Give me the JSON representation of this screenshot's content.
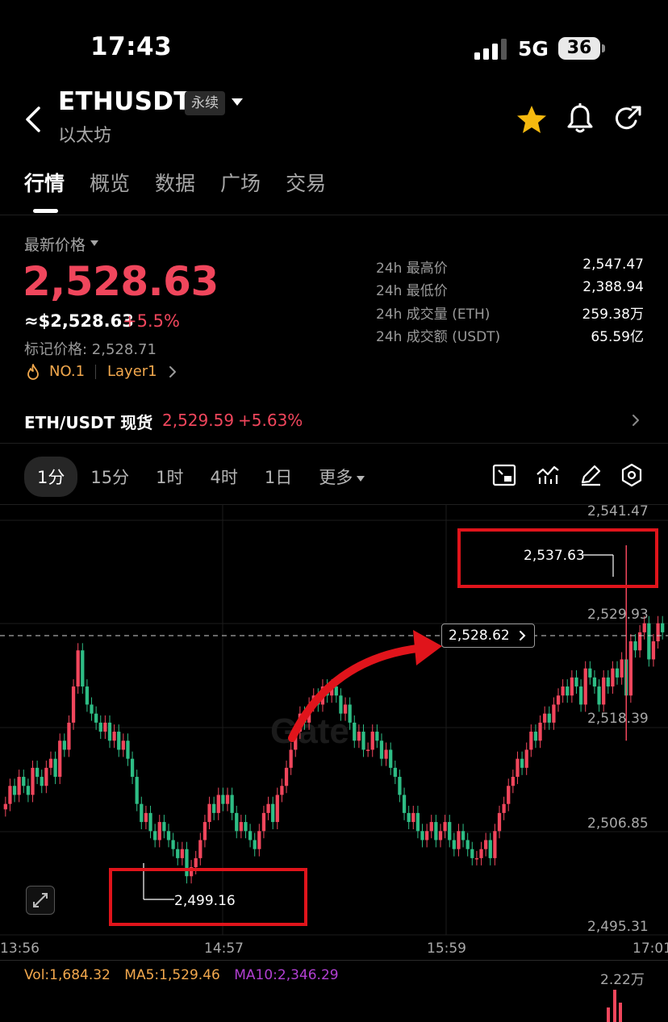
{
  "status_bar": {
    "time": "17:43",
    "network": "5G",
    "battery": "36"
  },
  "header": {
    "pair": "ETHUSDT",
    "contract_type": "永续",
    "name": "以太坊"
  },
  "tabs": [
    {
      "label": "行情",
      "active": true
    },
    {
      "label": "概览",
      "active": false
    },
    {
      "label": "数据",
      "active": false
    },
    {
      "label": "广场",
      "active": false
    },
    {
      "label": "交易",
      "active": false
    }
  ],
  "ticker": {
    "latest_label": "最新价格",
    "price": "2,528.63",
    "usd_price": "≈$2,528.63",
    "change": "+5.5%",
    "mark_price": "标记价格: 2,528.71",
    "rank_tag": "NO.1",
    "sector_tag": "Layer1",
    "stats": [
      {
        "label": "24h 最高价",
        "value": "2,547.47"
      },
      {
        "label": "24h 最低价",
        "value": "2,388.94"
      },
      {
        "label": "24h 成交量 (ETH)",
        "value": "259.38万"
      },
      {
        "label": "24h 成交额 (USDT)",
        "value": "65.59亿"
      }
    ]
  },
  "spot": {
    "name": "ETH/USDT 现货",
    "price": "2,529.59",
    "change": "+5.63%"
  },
  "intervals": [
    {
      "label": "1分",
      "active": true
    },
    {
      "label": "15分",
      "active": false
    },
    {
      "label": "1时",
      "active": false
    },
    {
      "label": "4时",
      "active": false
    },
    {
      "label": "1日",
      "active": false
    },
    {
      "label": "更多",
      "active": false
    }
  ],
  "tool_icons": [
    "chart-layout-icon",
    "indicator-icon",
    "draw-pen-icon",
    "settings-hex-icon"
  ],
  "colors": {
    "up": "#f0465c",
    "down": "#2ebd85",
    "accent": "#f2a84d",
    "annotation": "#e0141b"
  },
  "chart_data": {
    "type": "candlestick",
    "watermark": "Gate",
    "y_tick_labels": [
      "2,541.47",
      "2,529.93",
      "2,518.39",
      "2,506.85",
      "2,495.31"
    ],
    "x_tick_labels": [
      "13:56",
      "14:57",
      "15:59",
      "17:01"
    ],
    "ylim": [
      2495.31,
      2541.47
    ],
    "current_price": "2,528.62",
    "high_marker": "2,537.63",
    "low_marker": "2,499.16",
    "close_series": [
      2509,
      2511,
      2510,
      2512,
      2511,
      2510,
      2513,
      2512,
      2511,
      2513,
      2514,
      2512,
      2516,
      2515,
      2518,
      2522,
      2526,
      2522,
      2520,
      2519,
      2518,
      2517,
      2518,
      2516,
      2517,
      2515,
      2516,
      2514,
      2512,
      2509,
      2507,
      2508,
      2506,
      2505,
      2507,
      2506,
      2505,
      2504,
      2503,
      2504,
      2501,
      2502,
      2503,
      2505,
      2507,
      2509,
      2508,
      2510,
      2509,
      2510,
      2508,
      2506,
      2507,
      2506,
      2505,
      2504,
      2506,
      2508,
      2509,
      2507,
      2510,
      2511,
      2513,
      2515,
      2517,
      2519,
      2518,
      2520,
      2521,
      2520,
      2522,
      2521,
      2522,
      2521,
      2519,
      2520,
      2518,
      2516,
      2517,
      2515,
      2515,
      2517,
      2516,
      2514,
      2515,
      2513,
      2512,
      2510,
      2508,
      2507,
      2508,
      2506,
      2505,
      2506,
      2507,
      2505,
      2506,
      2507,
      2505,
      2504,
      2506,
      2505,
      2504,
      2503,
      2503,
      2504,
      2505,
      2503,
      2506,
      2508,
      2509,
      2511,
      2512,
      2514,
      2513,
      2515,
      2517,
      2516,
      2518,
      2519,
      2518,
      2520,
      2521,
      2522,
      2521,
      2523,
      2522,
      2520,
      2524,
      2523,
      2522,
      2520,
      2523,
      2522,
      2524,
      2523,
      2525,
      2521,
      2527,
      2526,
      2528,
      2529,
      2525,
      2527,
      2529,
      2528
    ],
    "volume_label": "2.22万",
    "indicators": {
      "vol": "Vol:1,684.32",
      "ma5": "MA5:1,529.46",
      "ma10": "MA10:2,346.29"
    }
  }
}
